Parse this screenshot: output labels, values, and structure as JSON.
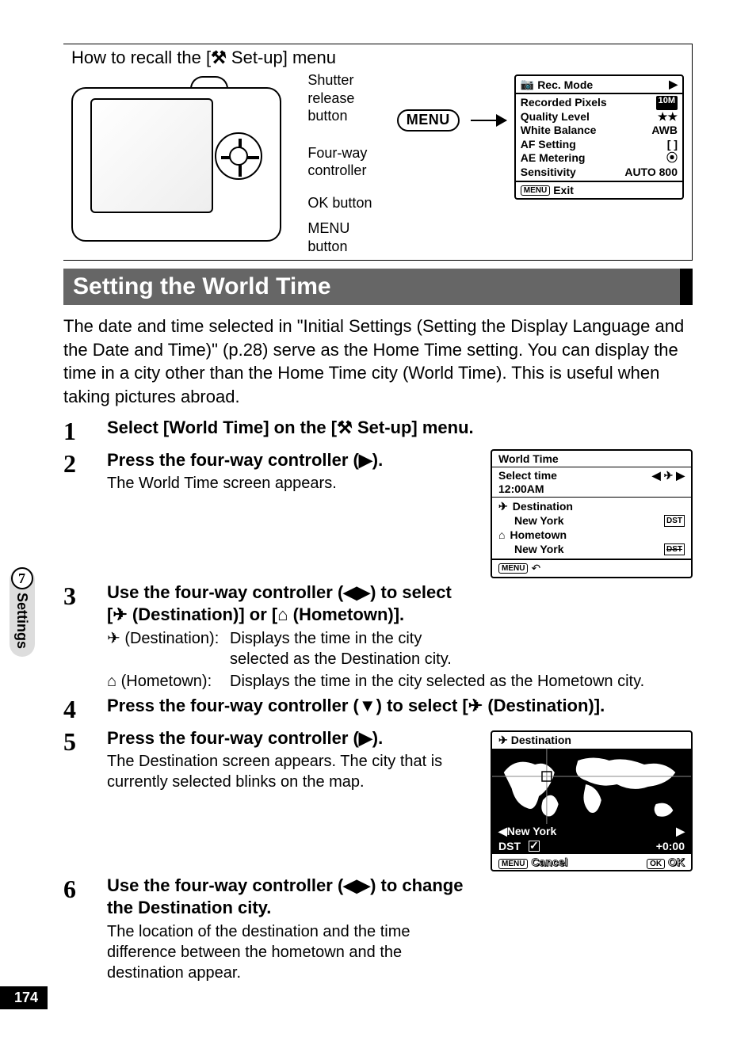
{
  "recall": {
    "title_prefix": "How to recall the [",
    "title_glyph": "⚒",
    "title_suffix": " Set-up] menu",
    "labels": {
      "shutter": "Shutter release button",
      "fourway": "Four-way controller",
      "ok": "OK button",
      "menu_btn": "MENU button"
    },
    "menu_button": "MENU"
  },
  "rec_mode": {
    "tab_icon": "📷",
    "tab": "Rec. Mode",
    "items": [
      {
        "label": "Recorded Pixels",
        "value": "10M"
      },
      {
        "label": "Quality Level",
        "value": "★★"
      },
      {
        "label": "White Balance",
        "value": "AWB"
      },
      {
        "label": "AF Setting",
        "value": "[  ]"
      },
      {
        "label": "AE Metering",
        "value": "⦿"
      },
      {
        "label": "Sensitivity",
        "value": "AUTO 800"
      }
    ],
    "exit_btn": "MENU",
    "exit": "Exit"
  },
  "section_title": "Setting the World Time",
  "intro": "The date and time selected in \"Initial Settings (Setting the Display Language and the Date and Time)\" (p.28) serve as the Home Time setting. You can display the time in a city other than the Home Time city (World Time). This is useful when taking pictures abroad.",
  "steps": {
    "s1": {
      "num": "1",
      "title_pre": "Select [World Time] on the [",
      "title_glyph": "⚒",
      "title_post": " Set-up] menu."
    },
    "s2": {
      "num": "2",
      "title": "Press the four-way controller (▶).",
      "desc": "The World Time screen appears."
    },
    "s3": {
      "num": "3",
      "title_pre": "Use the four-way controller (◀▶) to select [",
      "title_icon1": "✈",
      "title_mid": " (Destination)] or [",
      "title_icon2": "⌂",
      "title_post": " (Hometown)].",
      "def1_icon": "✈",
      "def1_term": " (Destination):",
      "def1_desc": "Displays the time in the city selected as the Destination city.",
      "def2_icon": "⌂",
      "def2_term": " (Hometown):",
      "def2_desc": "Displays the time in the city selected as the Hometown city."
    },
    "s4": {
      "num": "4",
      "title_pre": "Press the four-way controller (▼) to select [",
      "title_icon": "✈",
      "title_post": " (Destination)]."
    },
    "s5": {
      "num": "5",
      "title": "Press the four-way controller (▶).",
      "desc": "The Destination screen appears. The city that is currently selected blinks on the map."
    },
    "s6": {
      "num": "6",
      "title": "Use the four-way controller (◀▶) to change the Destination city.",
      "desc": "The location of the destination and the time difference between the hometown and the destination appear."
    }
  },
  "wt_screen": {
    "tab": "World Time",
    "select_time": "Select time",
    "select_arrows_left": "◀",
    "select_icon": "✈",
    "select_arrows_right": "▶",
    "time": "12:00AM",
    "dest_icon": "✈",
    "dest_label": "Destination",
    "dest_city": "New York",
    "dest_tag": "DST",
    "home_icon": "⌂",
    "home_label": "Hometown",
    "home_city": "New York",
    "home_tag": "DST",
    "footer_btn": "MENU",
    "footer_icon": "↶"
  },
  "dest_screen": {
    "header_icon": "✈",
    "header": "Destination",
    "city_left": "◀",
    "city": "New York",
    "city_right": "▶",
    "dst_label": "DST",
    "offset": "+0:00",
    "footer_btn": "MENU",
    "cancel": "Cancel",
    "ok_btn": "OK",
    "ok": "OK"
  },
  "side": {
    "section_num": "7",
    "section_label": "Settings"
  },
  "page_num": "174"
}
